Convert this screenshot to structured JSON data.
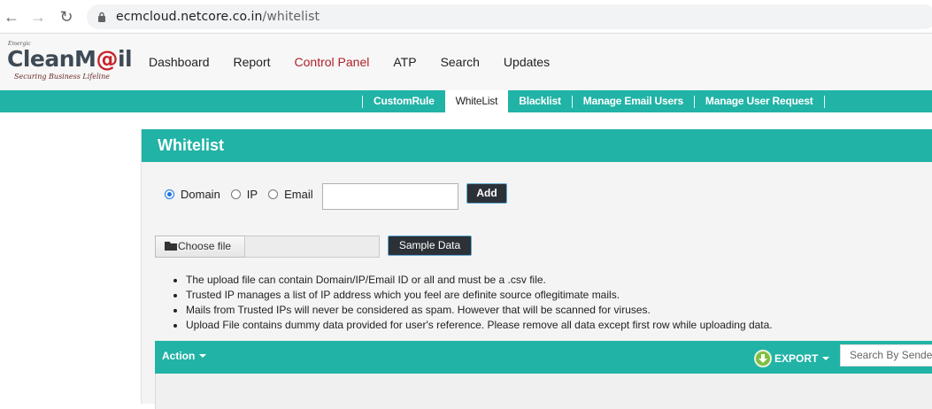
{
  "browser": {
    "url_host": "ecmcloud.netcore.co.in",
    "url_path": "/whitelist"
  },
  "logo": {
    "tiny": "Emergic",
    "brand_a": "Clean",
    "brand_b": "M",
    "brand_at": "@",
    "brand_c": "il",
    "tagline": "Securing Business Lifeline"
  },
  "main_nav": [
    "Dashboard",
    "Report",
    "Control Panel",
    "ATP",
    "Search",
    "Updates"
  ],
  "sub_nav": [
    "CustomRule",
    "WhiteList",
    "Blacklist",
    "Manage Email Users",
    "Manage User Request"
  ],
  "panel": {
    "title": "Whitelist",
    "radio_options": [
      "Domain",
      "IP",
      "Email"
    ],
    "selected_radio": "Domain",
    "add_label": "Add",
    "choose_file_label": "Choose file",
    "sample_data_label": "Sample Data",
    "notes": [
      "The upload file can contain Domain/IP/Email ID or all and must be a .csv file.",
      "Trusted IP manages a list of IP address which you feel are definite source oflegitimate mails.",
      "Mails from Trusted IPs will never be considered as spam. However that will be scanned for viruses.",
      "Upload File contains dummy data provided for user's reference. Please remove all data except first row while uploading data."
    ]
  },
  "table": {
    "action_label": "Action",
    "export_label": "EXPORT",
    "search_placeholder": "Search By Sender"
  },
  "colors": {
    "teal": "#21b3a6",
    "active_nav": "#b0202a",
    "button_dark": "#2c3137"
  }
}
